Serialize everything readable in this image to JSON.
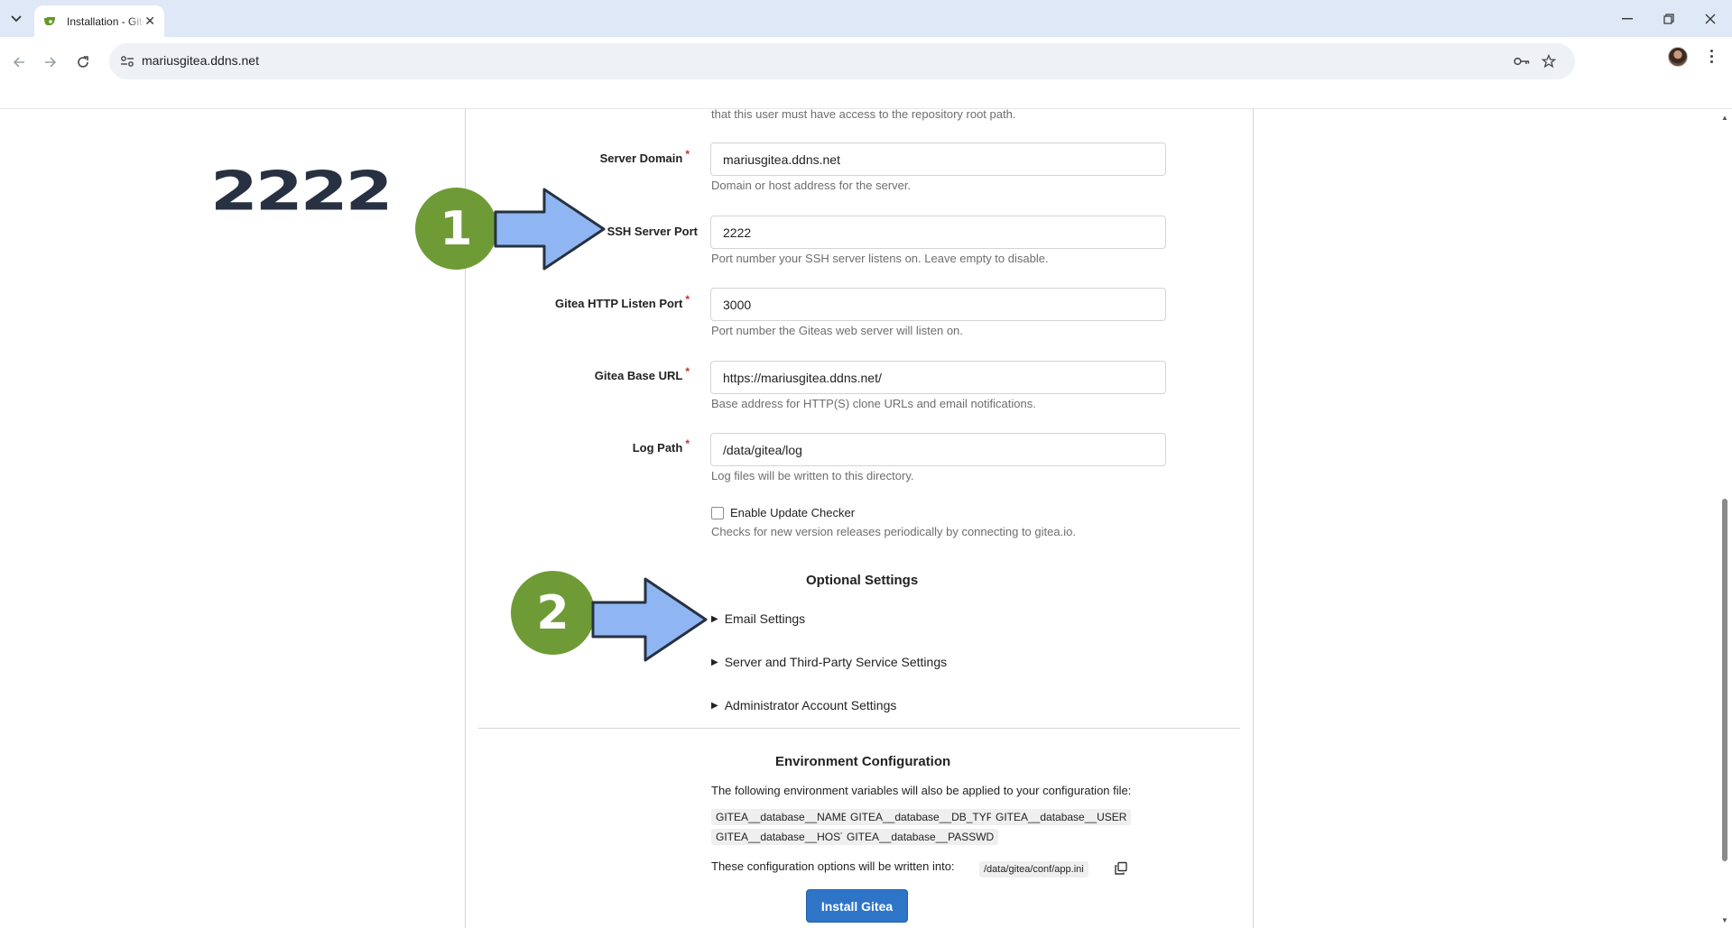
{
  "browser": {
    "tab_title": "Installation - Gitea",
    "url": "mariusgitea.ddns.net"
  },
  "form": {
    "top_helper_partial": "that this user must have access to the repository root path.",
    "server_domain": {
      "label": "Server Domain",
      "value": "mariusgitea.ddns.net",
      "helper": "Domain or host address for the server."
    },
    "ssh_port": {
      "label": "SSH Server Port",
      "value": "2222",
      "helper": "Port number your SSH server listens on. Leave empty to disable."
    },
    "http_port": {
      "label": "Gitea HTTP Listen Port",
      "value": "3000",
      "helper": "Port number the Giteas web server will listen on."
    },
    "base_url": {
      "label": "Gitea Base URL",
      "value": "https://mariusgitea.ddns.net/",
      "helper": "Base address for HTTP(S) clone URLs and email notifications."
    },
    "log_path": {
      "label": "Log Path",
      "value": "/data/gitea/log",
      "helper": "Log files will be written to this directory."
    },
    "update_checker": {
      "label": "Enable Update Checker",
      "checked": false,
      "helper": "Checks for new version releases periodically by connecting to gitea.io."
    },
    "required_marker": "*"
  },
  "optional_settings": {
    "title": "Optional Settings",
    "items": [
      "Email Settings",
      "Server and Third-Party Service Settings",
      "Administrator Account Settings"
    ]
  },
  "environment": {
    "title": "Environment Configuration",
    "description": "The following environment variables will also be applied to your configuration file:",
    "variables": [
      "GITEA__database__NAME",
      "GITEA__database__DB_TYPE",
      "GITEA__database__USER",
      "GITEA__database__HOST",
      "GITEA__database__PASSWD"
    ],
    "written_into_label": "These configuration options will be written into:",
    "config_path": "/data/gitea/conf/app.ini"
  },
  "install_button": "Install Gitea",
  "annotations": {
    "number_text": "2222",
    "badge_1": "1",
    "badge_2": "2",
    "badge_color": "#6f9b36",
    "arrow_color": "#8fb6f2"
  },
  "colors": {
    "accent_button": "#2e75c8",
    "required_star": "#db2828"
  }
}
